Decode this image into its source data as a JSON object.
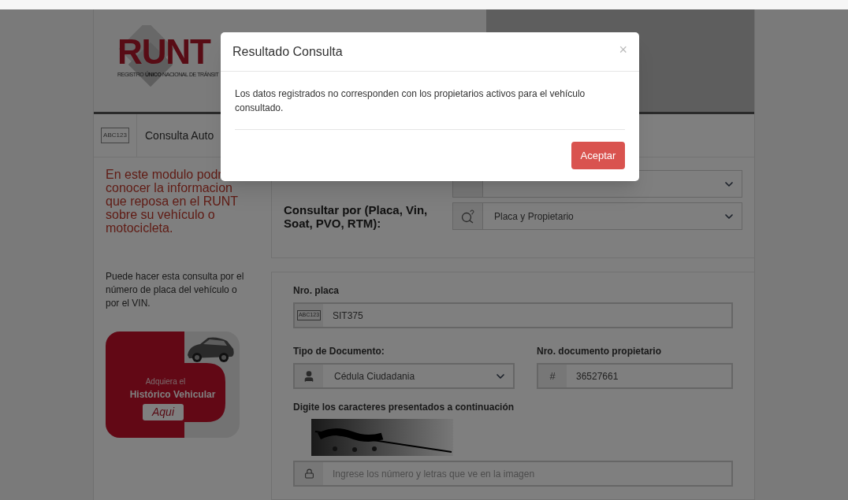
{
  "header": {
    "logo_text": "RUNT",
    "logo_subtitle": "REGISTRO **ÚNICO** NACIONAL DE TRÁNSIT"
  },
  "tab": {
    "badge": "ABC123",
    "label": "Consulta Auto"
  },
  "intro_lines": [
    "En este modulo podr",
    "conocer la informacion",
    "que reposa en el RUNT",
    "sobre su vehículo o",
    "motocicleta."
  ],
  "query_panel": {
    "consultar_label": "Consultar por (Placa, Vin, Soat, PVO, RTM):",
    "consultar_value": "Placa y Propietario"
  },
  "help_text": "Puede hacer esta consulta por el número de placa del vehículo o por el VIN.",
  "banner": {
    "line_1": "Adquiera el",
    "line_2": "Histórico Vehicular",
    "button": "Aqui"
  },
  "form": {
    "plate": {
      "label": "Nro. placa",
      "icon_text": "ABC123",
      "value": "SIT375"
    },
    "doc_type": {
      "label": "Tipo de Documento:",
      "value": "Cédula Ciudadania"
    },
    "doc_number": {
      "label": "Nro. documento propietario",
      "icon": "#",
      "value": "36527661"
    },
    "captcha": {
      "label": "Digite los caracteres presentados a continuación",
      "placeholder": "Ingrese los número y letras que ve en la imagen"
    }
  },
  "modal": {
    "title": "Resultado Consulta",
    "close": "×",
    "message": "Los datos registrados no corresponden con los propietarios activos para el vehículo consultado.",
    "button": "Aceptar"
  }
}
